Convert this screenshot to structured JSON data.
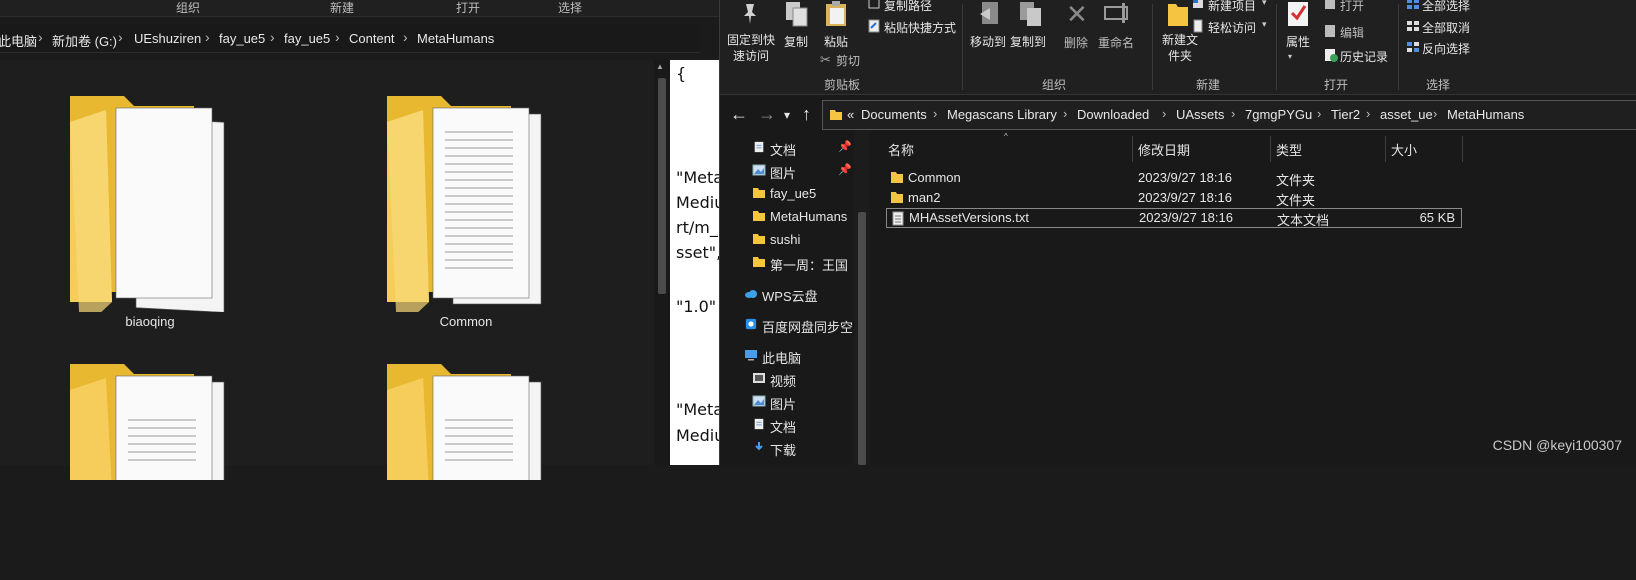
{
  "left_window": {
    "ribbon_groups": [
      "组织",
      "新建",
      "打开",
      "选择"
    ],
    "breadcrumb": [
      "此电脑",
      "新加卷 (G:)",
      "UEshuziren",
      "fay_ue5",
      "fay_ue5",
      "Content",
      "MetaHumans"
    ],
    "folders": [
      {
        "name": "biaoqing"
      },
      {
        "name": "Common"
      },
      {
        "name": ""
      },
      {
        "name": ""
      }
    ]
  },
  "text_panel": {
    "lines": [
      "{",
      "\"Meta",
      "Mediu",
      "rt/m_r",
      "sset\",",
      "\"1.0\"",
      "\"Meta",
      "Mediu"
    ]
  },
  "right_window": {
    "ribbon": {
      "pin_label": "固定到快速访问",
      "copy_label": "复制",
      "paste_label": "粘贴",
      "copy_path_label": "复制路径",
      "paste_shortcut_label": "粘贴快捷方式",
      "cut_label": "剪切",
      "move_to_label": "移动到",
      "copy_to_label": "复制到",
      "delete_label": "删除",
      "rename_label": "重命名",
      "new_folder_label": "新建文件夹",
      "new_item_label": "新建项目",
      "easy_access_label": "轻松访问",
      "properties_label": "属性",
      "open_label": "打开",
      "edit_label": "编辑",
      "history_label": "历史记录",
      "select_all_label": "全部选择",
      "select_none_label": "全部取消",
      "invert_selection_label": "反向选择",
      "group_clipboard": "剪贴板",
      "group_organize": "组织",
      "group_new": "新建",
      "group_open": "打开",
      "group_select": "选择"
    },
    "address": {
      "overflow": "«",
      "crumbs": [
        "Documents",
        "Megascans Library",
        "Downloaded",
        "UAssets",
        "7gmgPYGu",
        "Tier2",
        "asset_ue",
        "MetaHumans"
      ]
    },
    "nav_items": [
      {
        "label": "文档",
        "icon": "document-icon",
        "pinned": true
      },
      {
        "label": "图片",
        "icon": "picture-icon",
        "pinned": true
      },
      {
        "label": "fay_ue5",
        "icon": "folder-icon"
      },
      {
        "label": "MetaHumans",
        "icon": "folder-icon"
      },
      {
        "label": "sushi",
        "icon": "folder-icon"
      },
      {
        "label": "第一周：王国",
        "icon": "folder-icon"
      },
      {
        "label": "WPS云盘",
        "icon": "cloud-icon"
      },
      {
        "label": "百度网盘同步空间",
        "icon": "baidu-icon"
      },
      {
        "label": "此电脑",
        "icon": "pc-icon"
      },
      {
        "label": "视频",
        "icon": "video-icon"
      },
      {
        "label": "图片",
        "icon": "picture-icon"
      },
      {
        "label": "文档",
        "icon": "document-icon"
      },
      {
        "label": "下载",
        "icon": "download-icon"
      }
    ],
    "columns": [
      "名称",
      "修改日期",
      "类型",
      "大小"
    ],
    "files": [
      {
        "name": "Common",
        "date": "2023/9/27 18:16",
        "type": "文件夹",
        "size": "",
        "icon": "folder-icon"
      },
      {
        "name": "man2",
        "date": "2023/9/27 18:16",
        "type": "文件夹",
        "size": "",
        "icon": "folder-icon"
      },
      {
        "name": "MHAssetVersions.txt",
        "date": "2023/9/27 18:16",
        "type": "文本文档",
        "size": "65 KB",
        "icon": "text-file-icon",
        "selected": true
      }
    ]
  },
  "watermark": "CSDN @keyi100307",
  "colors": {
    "folder": "#f5c542",
    "folder_dark": "#d9a520",
    "background": "#191919",
    "selection": "#3a3a3a"
  }
}
